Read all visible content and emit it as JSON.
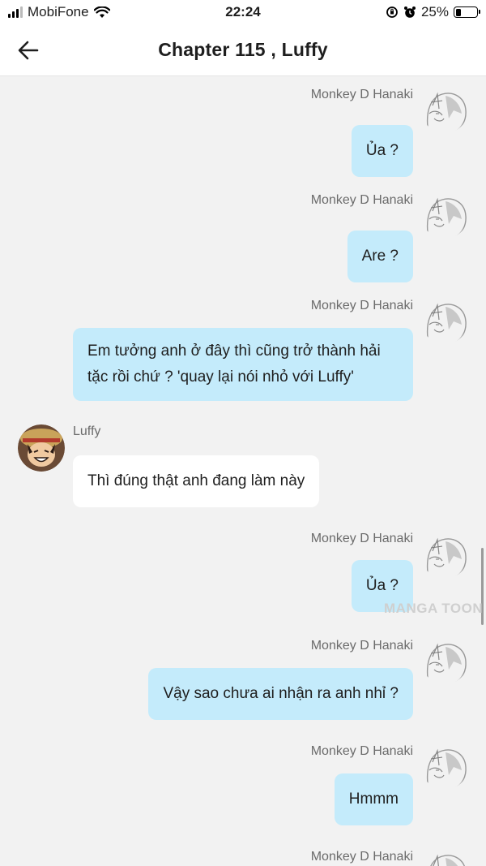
{
  "status_bar": {
    "carrier": "MobiFone",
    "time": "22:24",
    "battery": "25%",
    "battery_level": 0.25
  },
  "header": {
    "title": "Chapter 115 , Luffy"
  },
  "watermark": "MANGA TOON",
  "messages": [
    {
      "sender": "Monkey D Hanaki",
      "text": "Ủa ?"
    },
    {
      "sender": "Monkey D Hanaki",
      "text": "Are ?"
    },
    {
      "sender": "Monkey D Hanaki",
      "text": "Em tưởng anh ở đây thì cũng trở thành hải\ntặc rồi chứ ? 'quay lại nói nhỏ với Luffy'"
    },
    {
      "sender": "Luffy",
      "text": "Thì đúng thật anh đang làm này"
    },
    {
      "sender": "Monkey D Hanaki",
      "text": "Ủa ?"
    },
    {
      "sender": "Monkey D Hanaki",
      "text": "Vậy sao chưa ai nhận ra anh nhỉ ?"
    },
    {
      "sender": "Monkey D Hanaki",
      "text": "Hmmm"
    },
    {
      "sender": "Monkey D Hanaki",
      "text": ""
    }
  ]
}
